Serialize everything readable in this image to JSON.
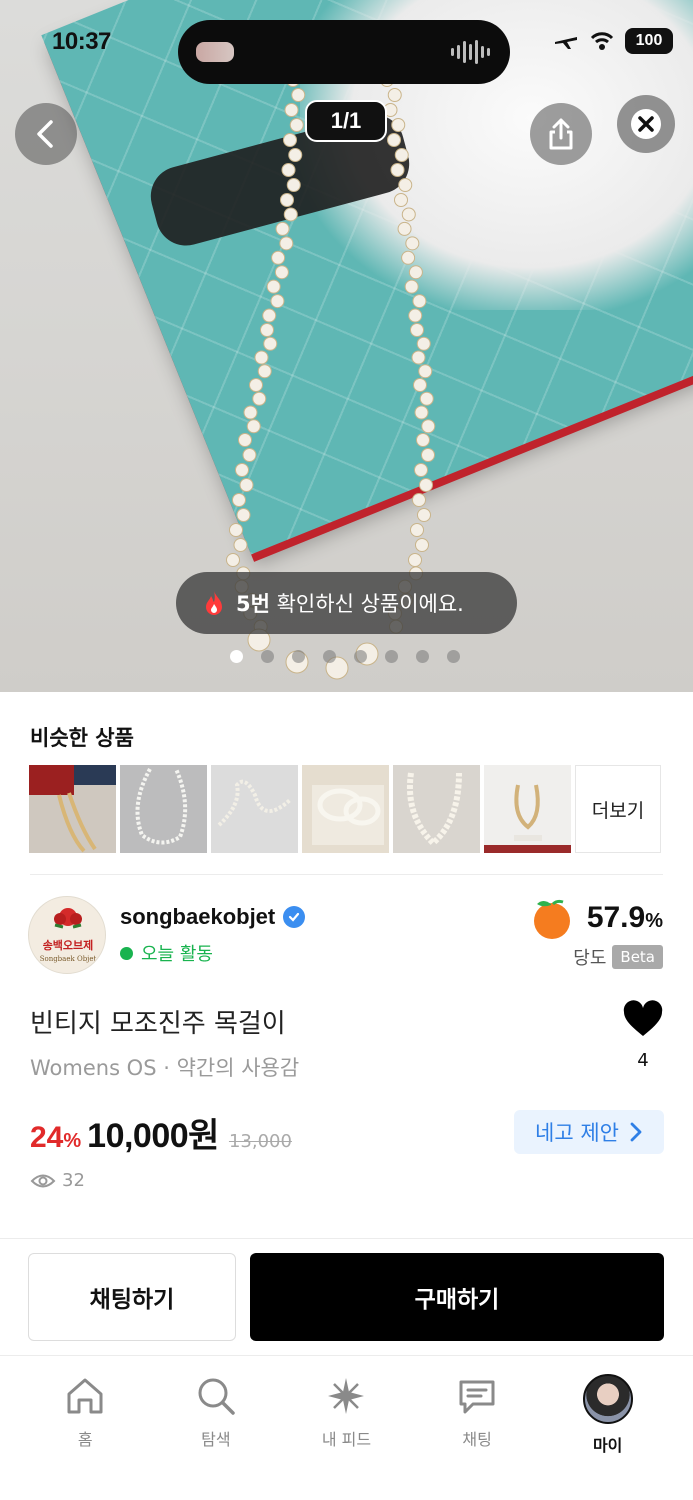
{
  "status_bar": {
    "time": "10:37",
    "battery": "100"
  },
  "hero": {
    "counter": "1/1",
    "toast_count": "5번",
    "toast_text": " 확인하신 상품이에요.",
    "page_dots": 8,
    "active_dot": 0
  },
  "similar": {
    "title": "비슷한 상품",
    "more_label": "더보기"
  },
  "seller": {
    "avatar_text_ko": "송백오브제",
    "avatar_text_en": "Songbaek Objet",
    "name": "songbaekobjet",
    "activity": "오늘 활동",
    "sweetness_value": "57.9",
    "sweetness_unit": "%",
    "sweetness_label": "당도",
    "beta_label": "Beta"
  },
  "product": {
    "title": "빈티지 모조진주 목걸이",
    "meta": "Womens OS · 약간의 사용감",
    "like_count": "4",
    "discount_value": "24",
    "discount_unit": "%",
    "price": "10,000원",
    "original_price": "13,000",
    "nego_label": "네고 제안",
    "views": "32"
  },
  "actions": {
    "chat": "채팅하기",
    "buy": "구매하기"
  },
  "tabs": [
    {
      "label": "홈",
      "icon": "home-icon"
    },
    {
      "label": "탐색",
      "icon": "search-icon"
    },
    {
      "label": "내 피드",
      "icon": "sparkle-icon"
    },
    {
      "label": "채팅",
      "icon": "chat-icon"
    },
    {
      "label": "마이",
      "icon": "profile-avatar",
      "active": true
    }
  ],
  "colors": {
    "discount": "#e12a2a",
    "nego_text": "#2f7fe6",
    "active_green": "#19b34f",
    "buy_button": "#000000"
  }
}
